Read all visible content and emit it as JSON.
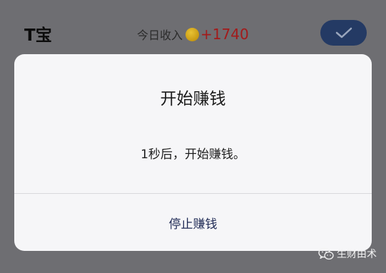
{
  "header": {
    "app_title": "T宝",
    "income_label": "今日收入",
    "income_icon": "coin-icon",
    "income_value": "+1740",
    "confirm_icon": "check-icon"
  },
  "modal": {
    "title": "开始赚钱",
    "message": "1秒后，开始赚钱。",
    "stop_button_label": "停止赚钱"
  },
  "watermark": {
    "icon": "wechat-icon",
    "text": "生财由术"
  },
  "colors": {
    "overlay": "#6e6e72",
    "modal_bg": "#f6f6f8",
    "confirm_button": "#243a64",
    "income_value": "#a31a1a",
    "stop_button_text": "#1f2a55"
  }
}
